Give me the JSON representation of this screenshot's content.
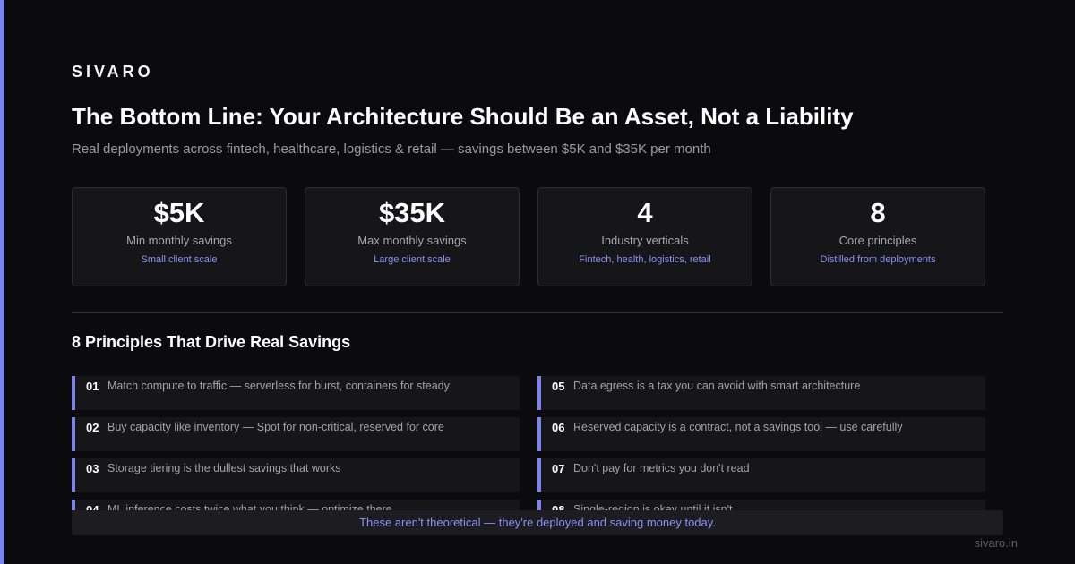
{
  "brand": "SIVARO",
  "title": "The Bottom Line: Your Architecture Should Be an Asset, Not a Liability",
  "subtitle": "Real deployments across fintech, healthcare, logistics & retail — savings between $5K and $35K per month",
  "stats": [
    {
      "value": "$5K",
      "label": "Min monthly savings",
      "note": "Small client scale"
    },
    {
      "value": "$35K",
      "label": "Max monthly savings",
      "note": "Large client scale"
    },
    {
      "value": "4",
      "label": "Industry verticals",
      "note": "Fintech, health, logistics, retail"
    },
    {
      "value": "8",
      "label": "Core principles",
      "note": "Distilled from deployments"
    }
  ],
  "section_title": "8 Principles That Drive Real Savings",
  "principles": [
    {
      "num": "01",
      "text": "Match compute to traffic — serverless for burst, containers for steady"
    },
    {
      "num": "02",
      "text": "Buy capacity like inventory — Spot for non-critical, reserved for core"
    },
    {
      "num": "03",
      "text": "Storage tiering is the dullest savings that works"
    },
    {
      "num": "04",
      "text": "ML inference costs twice what you think — optimize there"
    },
    {
      "num": "05",
      "text": "Data egress is a tax you can avoid with smart architecture"
    },
    {
      "num": "06",
      "text": "Reserved capacity is a contract, not a savings tool — use carefully"
    },
    {
      "num": "07",
      "text": "Don't pay for metrics you don't read"
    },
    {
      "num": "08",
      "text": "Single-region is okay until it isn't"
    }
  ],
  "banner": "These aren't theoretical — they're deployed and saving money today.",
  "footer_url": "sivaro.in",
  "colors": {
    "accent": "#7b83ee",
    "background": "#0b0b0d",
    "card": "#161619",
    "note_text": "#8a92f4"
  }
}
